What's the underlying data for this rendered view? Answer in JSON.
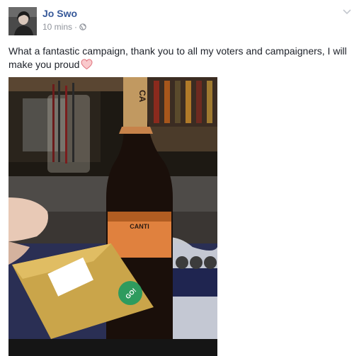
{
  "post": {
    "author": "Jo Swo",
    "timestamp": "10 mins",
    "separator": "·",
    "privacy_icon": "globe-icon",
    "menu_icon": "chevron-down-icon",
    "text": "What a fantastic campaign, thank you to all my voters and campaigners, I will make you proud",
    "emoji": "heart-icon",
    "photo": {
      "bottle_label_top": "CA",
      "bottle_label_main": "CANTI",
      "envelope_sticker": "GO!"
    }
  },
  "colors": {
    "author_link": "#365899",
    "meta_gray": "#90949c",
    "text": "#1d2129",
    "heart_fill": "#f9c9cc",
    "heart_stroke": "#e0737d"
  }
}
